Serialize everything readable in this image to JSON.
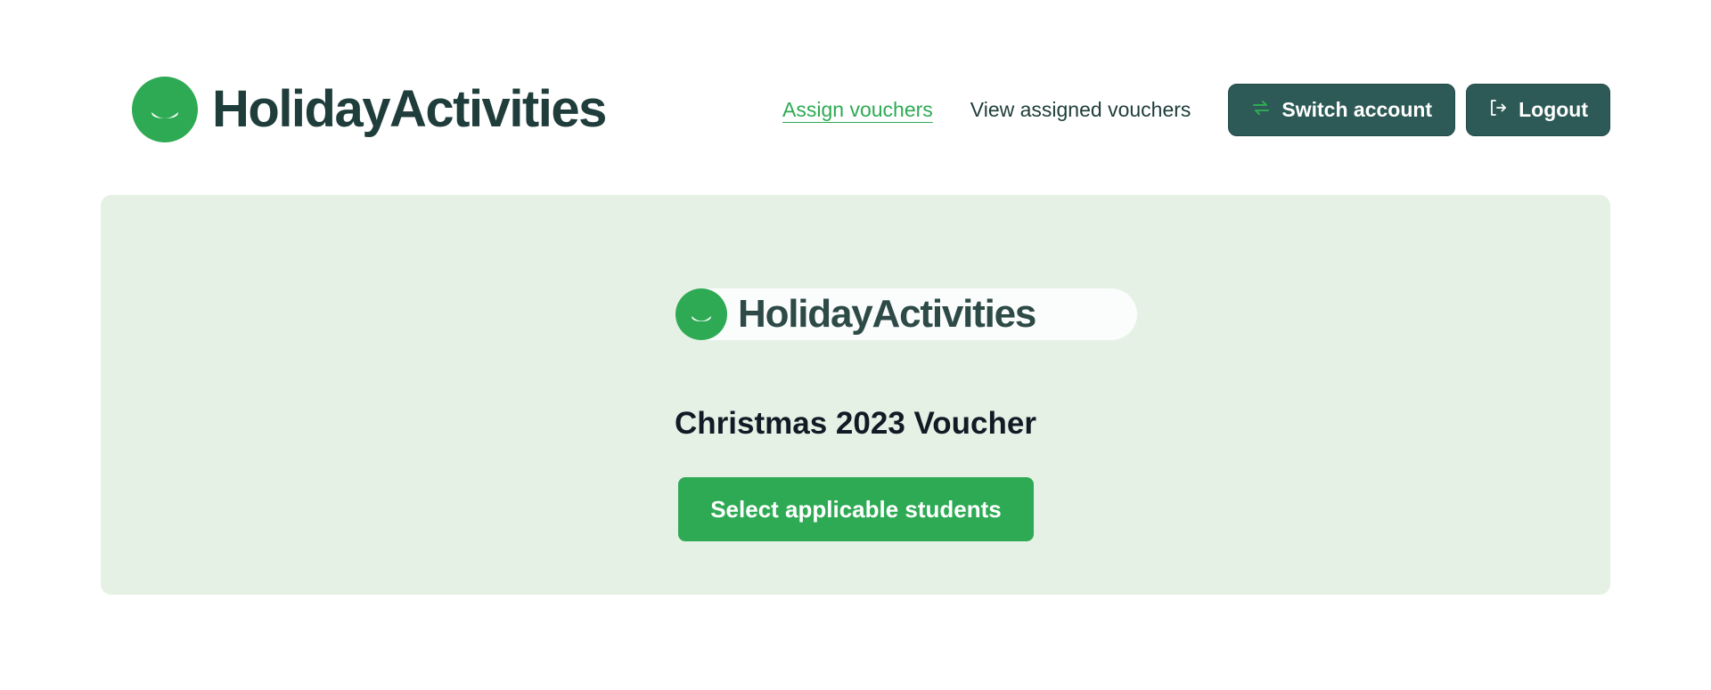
{
  "header": {
    "brand_name": "HolidayActivities",
    "nav": {
      "assign_vouchers": "Assign vouchers",
      "view_assigned_vouchers": "View assigned vouchers"
    },
    "switch_account_label": "Switch account",
    "logout_label": "Logout"
  },
  "panel": {
    "logo_name": "HolidayActivities",
    "voucher_title": "Christmas 2023 Voucher",
    "select_button_label": "Select applicable students"
  },
  "colors": {
    "brand_green": "#2eaa54",
    "dark_teal": "#2d5a56",
    "panel_bg": "#e6f1e5",
    "text_dark": "#1f3d3a"
  },
  "icons": {
    "switch_account": "arrows-switch-icon",
    "logout": "logout-arrow-icon",
    "brand": "smile-logo-icon"
  }
}
